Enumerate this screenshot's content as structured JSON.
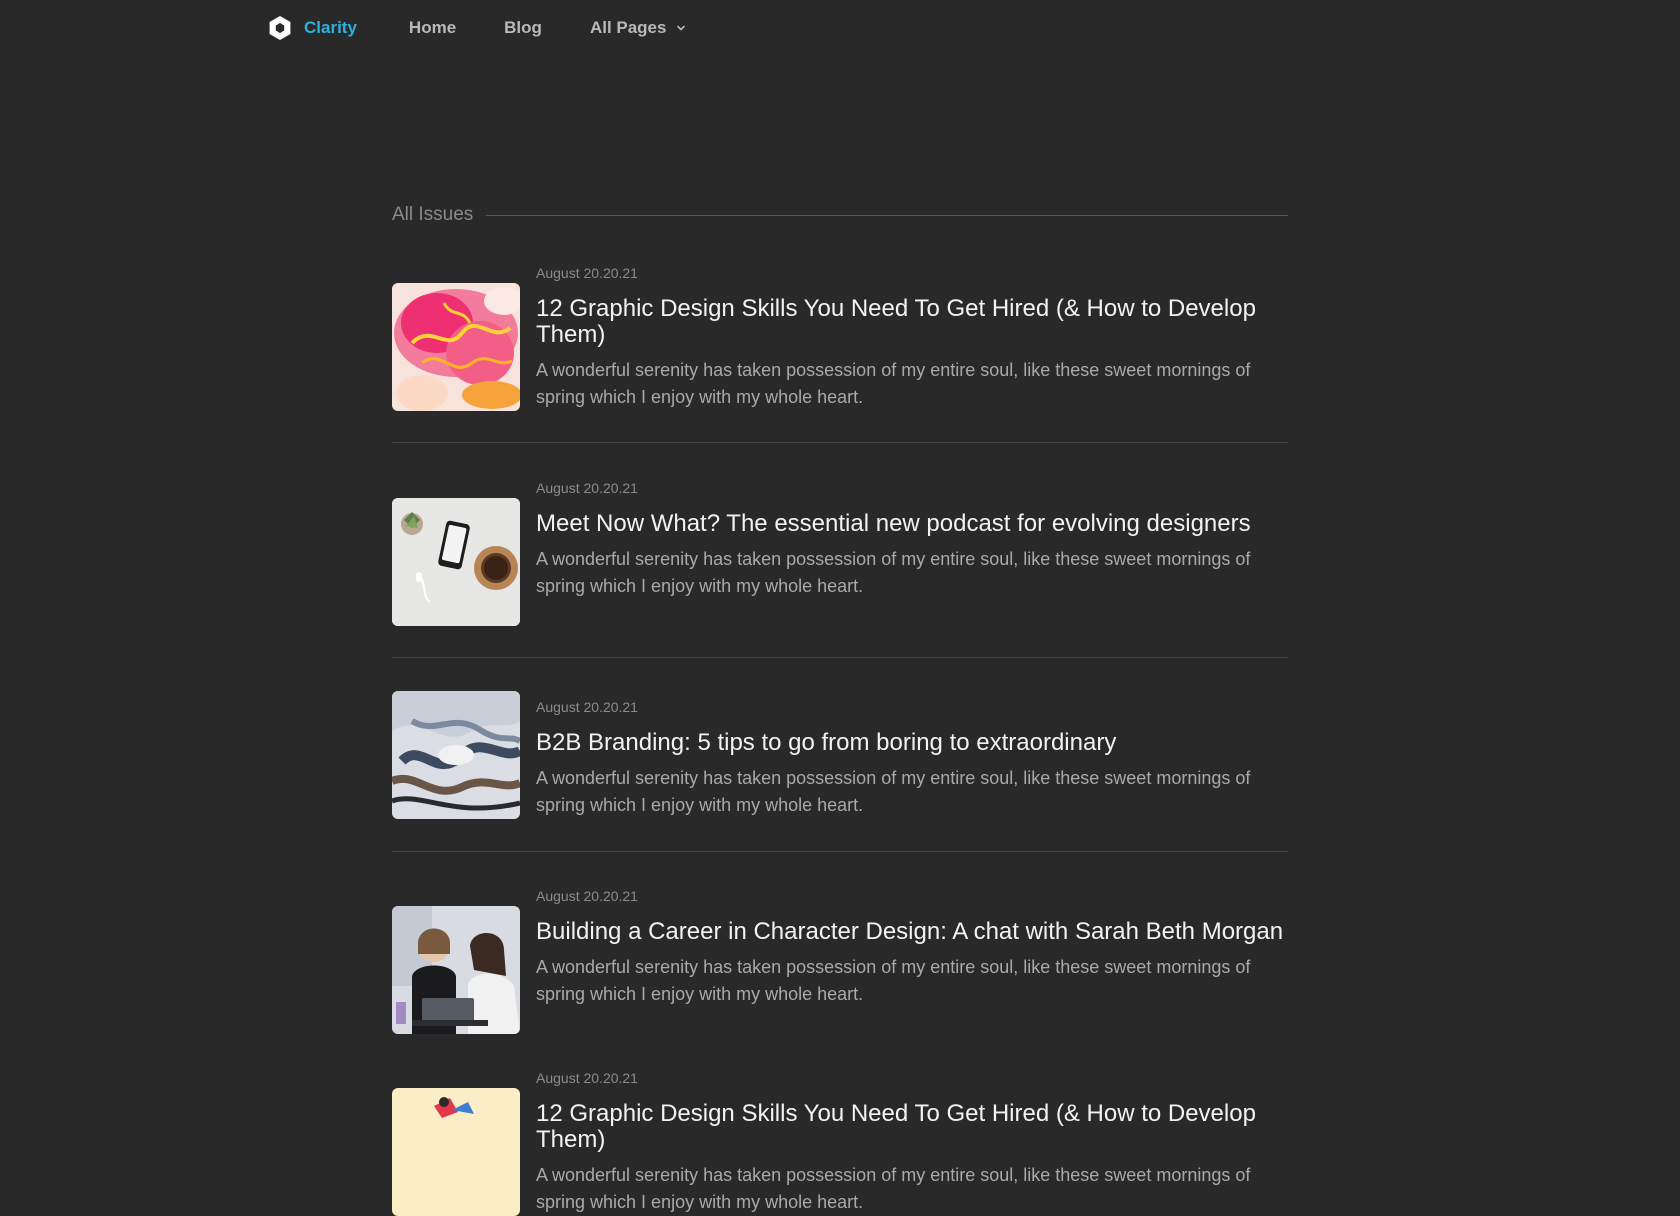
{
  "nav": {
    "brand": "Clarity",
    "home": "Home",
    "blog": "Blog",
    "all_pages": "All Pages"
  },
  "section": {
    "title": "All Issues"
  },
  "articles": [
    {
      "date": "August 20.20.21",
      "title": "12 Graphic Design Skills You Need To Get Hired (& How to Develop Them)",
      "excerpt": "A wonderful serenity has taken possession of my entire soul, like these sweet mornings of spring which I enjoy with my whole heart.",
      "image": "pink-orange-fluid-art"
    },
    {
      "date": "August 20.20.21",
      "title": "Meet Now What? The essential new podcast for evolving designers",
      "excerpt": "A wonderful serenity has taken possession of my entire soul, like these sweet mornings of spring which I enjoy with my whole heart.",
      "image": "desk-phone-plant-coffee"
    },
    {
      "date": "August 20.20.21",
      "title": "B2B Branding: 5 tips to go from boring to extraordinary",
      "excerpt": "A wonderful serenity has taken possession of my entire soul, like these sweet mornings of spring which I enjoy with my whole heart.",
      "image": "marble-swirl"
    },
    {
      "date": "August 20.20.21",
      "title": "Building a Career in Character Design: A chat with Sarah Beth Morgan",
      "excerpt": "A wonderful serenity has taken possession of my entire soul, like these sweet mornings of spring which I enjoy with my whole heart.",
      "image": "two-people-laptop"
    },
    {
      "date": "August 20.20.21",
      "title": "12 Graphic Design Skills You Need To Get Hired (& How to Develop Them)",
      "excerpt": "A wonderful serenity has taken possession of my entire soul, like these sweet mornings of spring which I enjoy with my whole heart.",
      "image": "illustration-cream"
    }
  ],
  "colors": {
    "background": "#292929",
    "brand": "#2ab3dd",
    "nav_text": "#b9b9b9",
    "title_text": "#f2f2f2",
    "muted_text": "#8b8b8b"
  }
}
